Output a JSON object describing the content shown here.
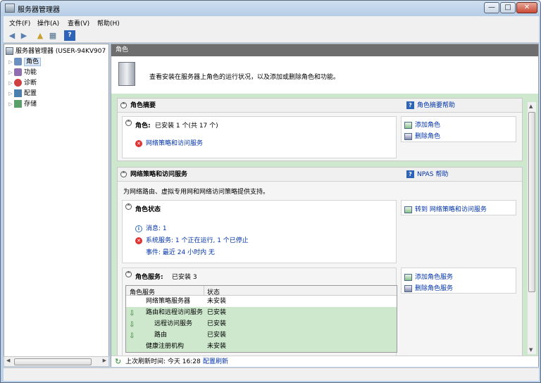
{
  "window": {
    "title": "服务器管理器",
    "minimize": "—",
    "maximize": "□",
    "close": "✕"
  },
  "menu": [
    "文件(F)",
    "操作(A)",
    "查看(V)",
    "帮助(H)"
  ],
  "tree": {
    "root": "服务器管理器 (USER-94KV907",
    "items": [
      "角色",
      "功能",
      "诊断",
      "配置",
      "存储"
    ]
  },
  "header": {
    "title": "角色",
    "intro": "查看安装在服务器上角色的运行状况，以及添加或删除角色和功能。"
  },
  "summary": {
    "title": "角色摘要",
    "help": "角色摘要帮助",
    "roles_label": "角色:",
    "roles_value": "已安装 1 个(共 17 个)",
    "installed_role": "网络策略和访问服务",
    "add_role": "添加角色",
    "remove_role": "删除角色"
  },
  "npas": {
    "title": "网络策略和访问服务",
    "help": "NPAS 帮助",
    "description": "为网络路由、虚拟专用网和网络访问策略提供支持。",
    "status_title": "角色状态",
    "goto": "转到 网络策略和访问服务",
    "messages": "消息: 1",
    "system_services": "系统服务: 1 个正在运行, 1 个已停止",
    "events": "事件: 最近 24 小时内 无",
    "services_label": "角色服务:",
    "services_value": "已安装 3",
    "add_service": "添加角色服务",
    "remove_service": "删除角色服务",
    "table_headers": [
      "角色服务",
      "状态"
    ],
    "rows": [
      {
        "name": "网络策略服务器",
        "status": "未安装",
        "installed": false,
        "indent": false
      },
      {
        "name": "路由和远程访问服务",
        "status": "已安装",
        "installed": true,
        "indent": false
      },
      {
        "name": "远程访问服务",
        "status": "已安装",
        "installed": true,
        "indent": true
      },
      {
        "name": "路由",
        "status": "已安装",
        "installed": true,
        "indent": true
      },
      {
        "name": "健康注册机构",
        "status": "未安装",
        "installed": false,
        "indent": false
      }
    ]
  },
  "statusbar": {
    "last_refresh": "上次刷新时间: 今天 16:28",
    "configure": "配置刷新"
  }
}
